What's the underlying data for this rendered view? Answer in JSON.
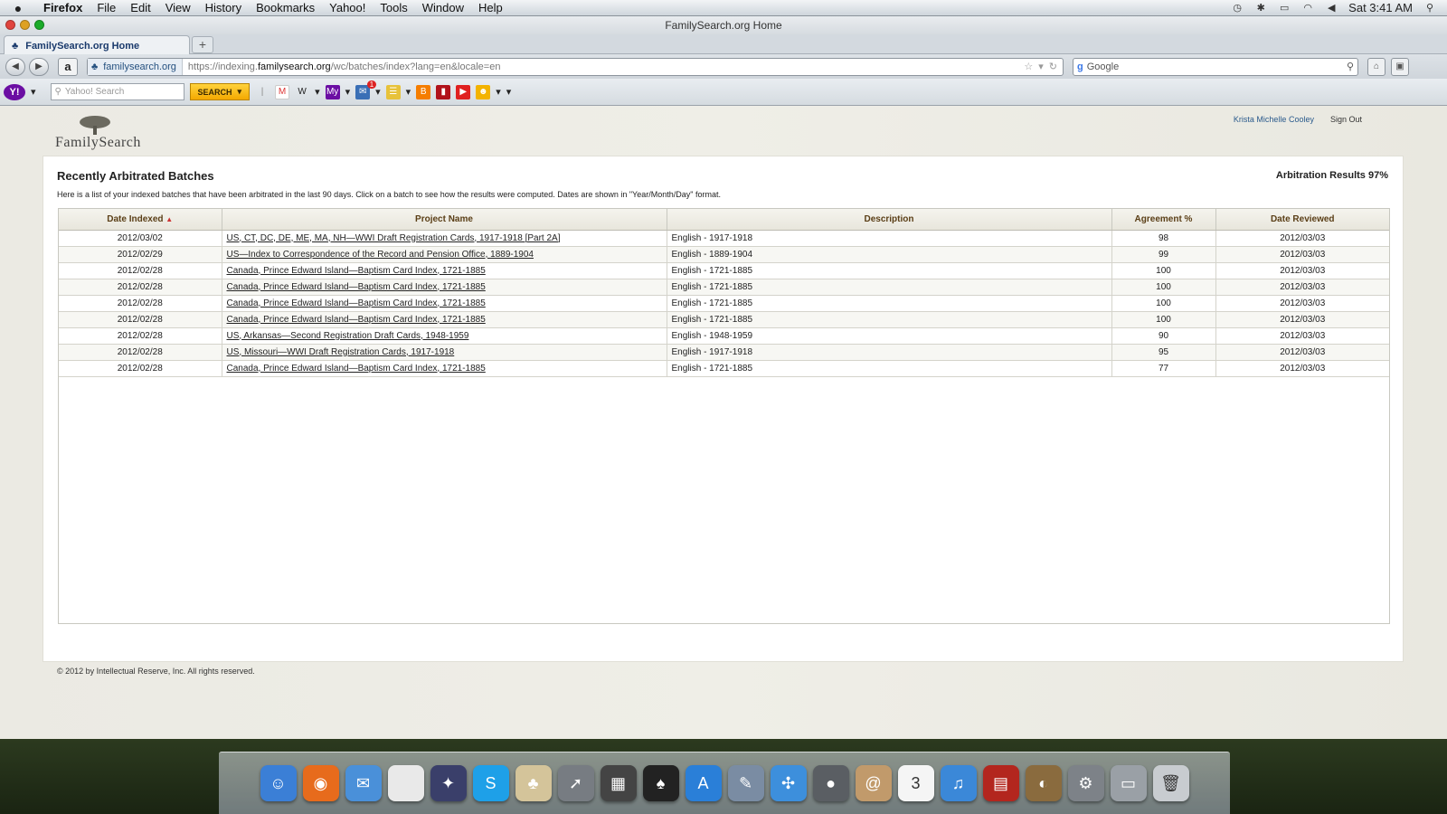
{
  "menubar": {
    "app_name": "Firefox",
    "items": [
      "File",
      "Edit",
      "View",
      "History",
      "Bookmarks",
      "Yahoo!",
      "Tools",
      "Window",
      "Help"
    ],
    "clock": "Sat 3:41 AM"
  },
  "window": {
    "title": "FamilySearch.org Home"
  },
  "tab": {
    "label": "FamilySearch.org Home",
    "new_tab": "+"
  },
  "navbar": {
    "site_identity": "familysearch.org",
    "url_prefix": "https://indexing.",
    "url_domain": "familysearch.org",
    "url_path": "/wc/batches/index?lang=en&locale=en",
    "search_placeholder": "Google"
  },
  "yahoo_toolbar": {
    "logo": "Y!",
    "search_placeholder": "Yahoo! Search",
    "search_button": "SEARCH",
    "mail_badge": "1"
  },
  "page": {
    "logo_text": "FamilySearch",
    "user_name": "Krista Michelle Cooley",
    "sign_out": "Sign Out",
    "title": "Recently Arbitrated Batches",
    "arbitration_results": "Arbitration Results 97%",
    "description": "Here is a list of your indexed batches that have been arbitrated in the last 90 days.  Click on a batch to see how the results were computed.  Dates are shown in \"Year/Month/Day\" format.",
    "footer": "© 2012 by Intellectual Reserve, Inc. All rights reserved."
  },
  "table": {
    "columns": [
      "Date Indexed",
      "Project Name",
      "Description",
      "Agreement %",
      "Date Reviewed"
    ],
    "rows": [
      {
        "date_indexed": "2012/03/02",
        "project": "US, CT, DC, DE, ME, MA, NH—WWI Draft Registration Cards, 1917-1918 [Part 2A]",
        "description": "English - 1917-1918",
        "agreement": "98",
        "date_reviewed": "2012/03/03"
      },
      {
        "date_indexed": "2012/02/29",
        "project": "US—Index to Correspondence of the Record and Pension Office, 1889-1904",
        "description": "English - 1889-1904",
        "agreement": "99",
        "date_reviewed": "2012/03/03"
      },
      {
        "date_indexed": "2012/02/28",
        "project": "Canada, Prince Edward Island—Baptism Card Index, 1721-1885",
        "description": "English - 1721-1885",
        "agreement": "100",
        "date_reviewed": "2012/03/03"
      },
      {
        "date_indexed": "2012/02/28",
        "project": "Canada, Prince Edward Island—Baptism Card Index, 1721-1885",
        "description": "English - 1721-1885",
        "agreement": "100",
        "date_reviewed": "2012/03/03"
      },
      {
        "date_indexed": "2012/02/28",
        "project": "Canada, Prince Edward Island—Baptism Card Index, 1721-1885",
        "description": "English - 1721-1885",
        "agreement": "100",
        "date_reviewed": "2012/03/03"
      },
      {
        "date_indexed": "2012/02/28",
        "project": "Canada, Prince Edward Island—Baptism Card Index, 1721-1885",
        "description": "English - 1721-1885",
        "agreement": "100",
        "date_reviewed": "2012/03/03"
      },
      {
        "date_indexed": "2012/02/28",
        "project": "US, Arkansas—Second Registration Draft Cards, 1948-1959",
        "description": "English - 1948-1959",
        "agreement": "90",
        "date_reviewed": "2012/03/03"
      },
      {
        "date_indexed": "2012/02/28",
        "project": "US, Missouri—WWI Draft Registration Cards, 1917-1918",
        "description": "English - 1917-1918",
        "agreement": "95",
        "date_reviewed": "2012/03/03"
      },
      {
        "date_indexed": "2012/02/28",
        "project": "Canada, Prince Edward Island—Baptism Card Index, 1721-1885",
        "description": "English - 1721-1885",
        "agreement": "77",
        "date_reviewed": "2012/03/03"
      }
    ]
  },
  "dock": {
    "apps": [
      {
        "icon": "finder-icon",
        "color": "#3b7fd6",
        "glyph": "☺"
      },
      {
        "icon": "firefox-icon",
        "color": "#e76b1c",
        "glyph": "◉"
      },
      {
        "icon": "mail-bird-icon",
        "color": "#4a90d9",
        "glyph": "✉"
      },
      {
        "icon": "document-icon",
        "color": "#e9e9e9",
        "glyph": ""
      },
      {
        "icon": "magic-hat-icon",
        "color": "#3a3f6a",
        "glyph": "✦"
      },
      {
        "icon": "skype-icon",
        "color": "#1ea0e8",
        "glyph": "S"
      },
      {
        "icon": "familysearch-app-icon",
        "color": "#d4c49a",
        "glyph": "♣"
      },
      {
        "icon": "launchpad-icon",
        "color": "#777c82",
        "glyph": "➚"
      },
      {
        "icon": "photo-booth-icon",
        "color": "#444",
        "glyph": "▦"
      },
      {
        "icon": "solitaire-icon",
        "color": "#222",
        "glyph": "♠"
      },
      {
        "icon": "app-store-icon",
        "color": "#2a7fd8",
        "glyph": "A"
      },
      {
        "icon": "preview-icon",
        "color": "#7a8ca3",
        "glyph": "✎"
      },
      {
        "icon": "safari-icon",
        "color": "#3d8fdc",
        "glyph": "✣"
      },
      {
        "icon": "facetime-icon",
        "color": "#5a5e63",
        "glyph": "●"
      },
      {
        "icon": "address-book-icon",
        "color": "#c19a6b",
        "glyph": "@"
      },
      {
        "icon": "ical-icon",
        "color": "#f5f5f5",
        "glyph": "3"
      },
      {
        "icon": "itunes-icon",
        "color": "#3b88d8",
        "glyph": "♫"
      },
      {
        "icon": "photo-stack-icon",
        "color": "#b3261e",
        "glyph": "▤"
      },
      {
        "icon": "iphoto-icon",
        "color": "#8a6b3e",
        "glyph": "◐"
      },
      {
        "icon": "system-preferences-icon",
        "color": "#7d8288",
        "glyph": "⚙"
      },
      {
        "icon": "folder-stack-icon",
        "color": "#9aa0a6",
        "glyph": "▭"
      },
      {
        "icon": "trash-icon",
        "color": "#c8ccd0",
        "glyph": "🗑"
      }
    ]
  }
}
